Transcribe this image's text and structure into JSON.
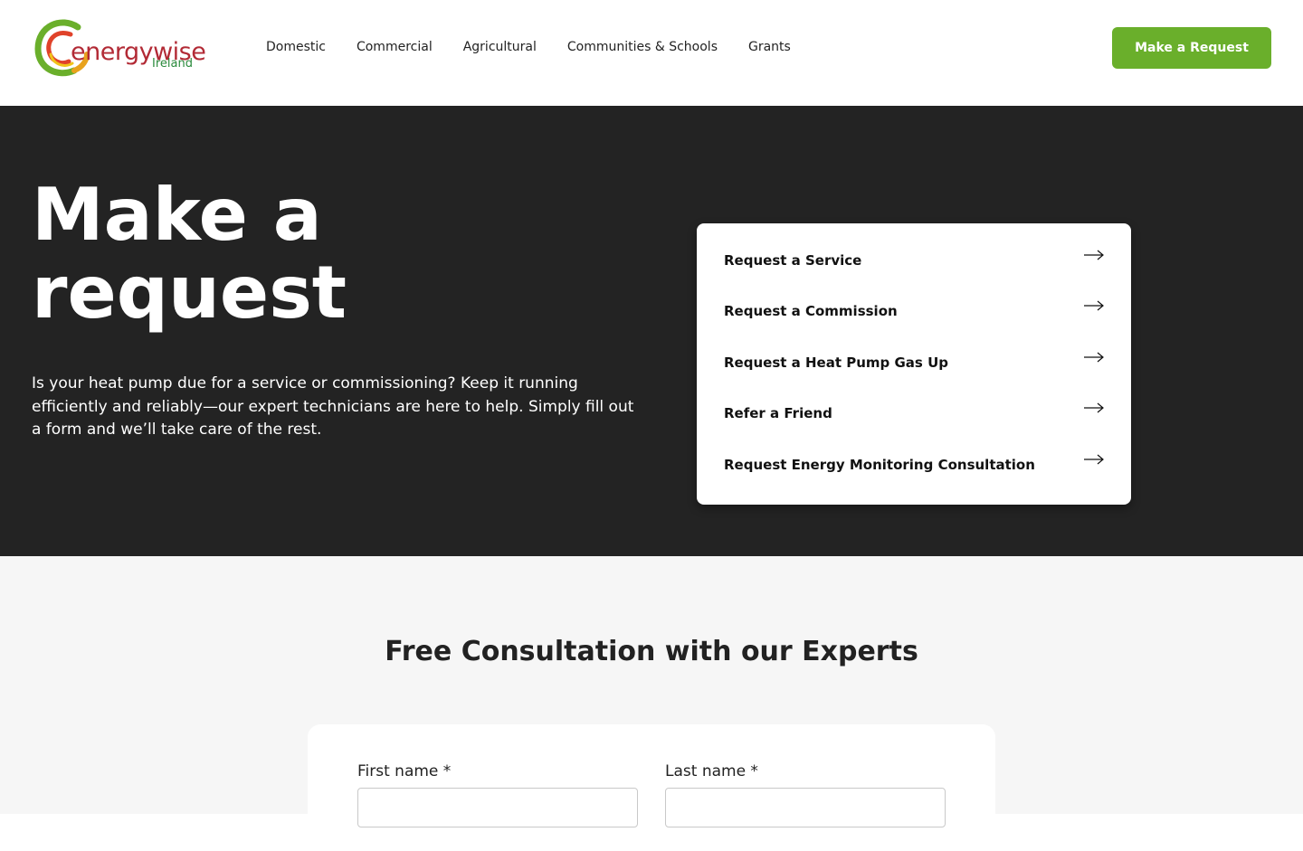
{
  "brand": {
    "logo_word": "energywise",
    "logo_sub": "Ireland",
    "primary_color": "#6aaf2b",
    "logo_red": "#b22a35",
    "logo_green": "#2a8a3c"
  },
  "nav": {
    "items": [
      {
        "label": "Domestic"
      },
      {
        "label": "Commercial"
      },
      {
        "label": "Agricultural"
      },
      {
        "label": "Communities & Schools"
      },
      {
        "label": "Grants"
      }
    ],
    "cta_label": "Make a Request"
  },
  "hero": {
    "title": "Make a request",
    "description": "Is your heat pump due for a service or commissioning? Keep it running efficiently and reliably—our expert technicians are here to help. Simply fill out a form  and we’ll take care of the rest.",
    "background": "#232323"
  },
  "requests": {
    "items": [
      {
        "label": "Request a Service",
        "icon": "arrow-right-icon"
      },
      {
        "label": "Request a Commission",
        "icon": "arrow-right-icon"
      },
      {
        "label": "Request a Heat Pump Gas Up",
        "icon": "arrow-right-icon"
      },
      {
        "label": "Refer a Friend",
        "icon": "arrow-right-icon"
      },
      {
        "label": "Request Energy Monitoring Consultation",
        "icon": "arrow-right-icon"
      }
    ]
  },
  "consultation": {
    "title": "Free Consultation with our Experts",
    "fields": {
      "first_name_label": "First name *",
      "first_name_value": "",
      "last_name_label": "Last name *",
      "last_name_value": ""
    }
  }
}
